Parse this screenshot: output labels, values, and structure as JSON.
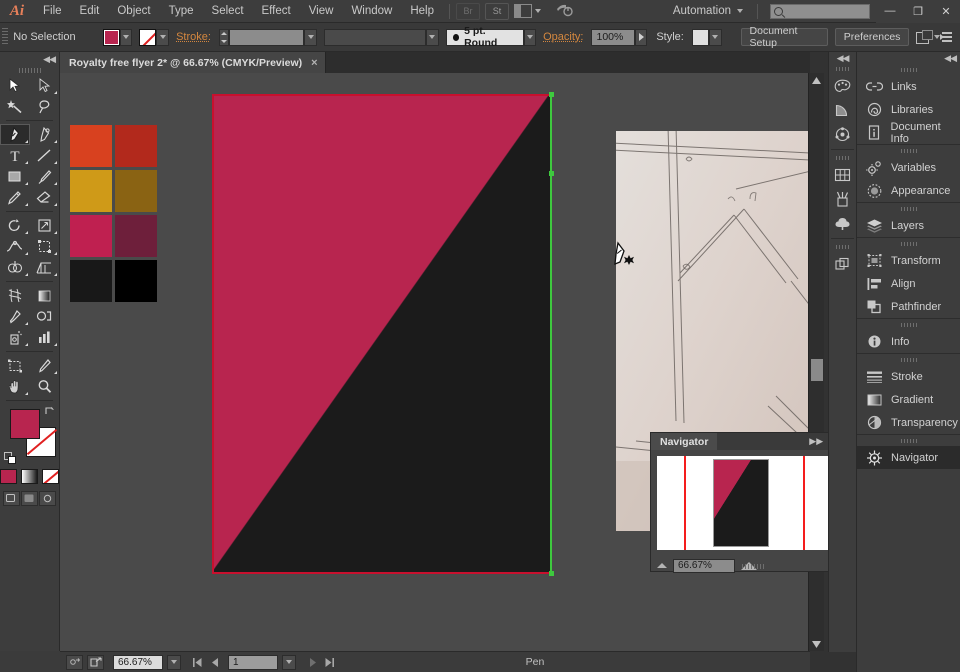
{
  "app": {
    "name": "Adobe Illustrator",
    "logo_text": "Ai"
  },
  "menubar": {
    "items": [
      "File",
      "Edit",
      "Object",
      "Type",
      "Select",
      "Effect",
      "View",
      "Window",
      "Help"
    ],
    "bridge_label": "Br",
    "stock_label": "St",
    "workspace_label": "Automation",
    "search_placeholder": "",
    "window_buttons": {
      "minimize": "—",
      "restore": "❐",
      "close": "✕"
    }
  },
  "controlbar": {
    "selection_state": "No Selection",
    "fill_color": "#b8254f",
    "stroke_color": "none",
    "stroke_label": "Stroke:",
    "stroke_weight": "",
    "brush_definition": "5 pt. Round",
    "opacity_label": "Opacity:",
    "opacity_value": "100%",
    "style_label": "Style:",
    "document_setup_label": "Document Setup",
    "preferences_label": "Preferences"
  },
  "tabbar": {
    "document_title": "Royalty free flyer 2* @ 66.67%  (CMYK/Preview)",
    "close_glyph": "×"
  },
  "toolbar": {
    "tools": [
      {
        "name": "selection-tool",
        "row": 0,
        "col": 0
      },
      {
        "name": "direct-selection-tool",
        "row": 0,
        "col": 1
      },
      {
        "name": "magic-wand-tool",
        "row": 1,
        "col": 0
      },
      {
        "name": "lasso-tool",
        "row": 1,
        "col": 1
      },
      {
        "name": "pen-tool",
        "row": 2,
        "col": 0,
        "active": true
      },
      {
        "name": "curvature-tool",
        "row": 2,
        "col": 1
      },
      {
        "name": "type-tool",
        "row": 3,
        "col": 0
      },
      {
        "name": "line-segment-tool",
        "row": 3,
        "col": 1
      },
      {
        "name": "rectangle-tool",
        "row": 4,
        "col": 0
      },
      {
        "name": "paintbrush-tool",
        "row": 4,
        "col": 1
      },
      {
        "name": "pencil-tool",
        "row": 5,
        "col": 0
      },
      {
        "name": "eraser-tool",
        "row": 5,
        "col": 1
      },
      {
        "name": "rotate-tool",
        "row": 6,
        "col": 0
      },
      {
        "name": "scale-tool",
        "row": 6,
        "col": 1
      },
      {
        "name": "width-tool",
        "row": 7,
        "col": 0
      },
      {
        "name": "free-transform-tool",
        "row": 7,
        "col": 1
      },
      {
        "name": "shape-builder-tool",
        "row": 8,
        "col": 0
      },
      {
        "name": "perspective-grid-tool",
        "row": 8,
        "col": 1
      },
      {
        "name": "mesh-tool",
        "row": 9,
        "col": 0
      },
      {
        "name": "gradient-tool",
        "row": 9,
        "col": 1
      },
      {
        "name": "eyedropper-tool",
        "row": 10,
        "col": 0
      },
      {
        "name": "blend-tool",
        "row": 10,
        "col": 1
      },
      {
        "name": "symbol-sprayer-tool",
        "row": 11,
        "col": 0
      },
      {
        "name": "column-graph-tool",
        "row": 11,
        "col": 1
      },
      {
        "name": "artboard-tool",
        "row": 12,
        "col": 0
      },
      {
        "name": "slice-tool",
        "row": 12,
        "col": 1
      },
      {
        "name": "hand-tool",
        "row": 13,
        "col": 0
      },
      {
        "name": "zoom-tool",
        "row": 13,
        "col": 1
      }
    ],
    "fill_color": "#b8254f",
    "stroke_color": "#ffffff"
  },
  "canvas": {
    "artboard": {
      "background_color": "#1b1b1b",
      "accent_color": "#b8254f",
      "border_color": "#c8102e",
      "selection_color": "#3ec93e"
    },
    "linked_photo": {
      "description": "pencil-sketch-paper-photo",
      "paper_color": "#ded6d0"
    },
    "swatch_palette": [
      [
        "#d8411f",
        "#b2291c"
      ],
      [
        "#cf9a18",
        "#8a6313"
      ],
      [
        "#bf2050",
        "#6e1f3b"
      ],
      [
        "#181818",
        "#000000"
      ]
    ]
  },
  "dock_collapsed": {
    "items": [
      {
        "label": "Color",
        "icon": "palette-icon"
      },
      {
        "label": "Color Guide",
        "icon": "color-guide-icon"
      },
      {
        "label": "Edit Colors",
        "icon": "edit-colors-icon"
      },
      {
        "label": "Swatches",
        "icon": "swatches-icon"
      },
      {
        "label": "Brushes",
        "icon": "brushes-icon"
      },
      {
        "label": "Symbols",
        "icon": "symbols-icon"
      },
      {
        "label": "Artboards",
        "icon": "artboards-icon"
      }
    ]
  },
  "dock_expanded": {
    "groups": [
      {
        "items": [
          {
            "label": "Links",
            "icon": "link-icon"
          },
          {
            "label": "Libraries",
            "icon": "libraries-icon"
          },
          {
            "label": "Document Info",
            "icon": "document-info-icon"
          }
        ]
      },
      {
        "items": [
          {
            "label": "Variables",
            "icon": "variables-icon"
          },
          {
            "label": "Appearance",
            "icon": "appearance-icon"
          }
        ]
      },
      {
        "items": [
          {
            "label": "Layers",
            "icon": "layers-icon"
          }
        ]
      },
      {
        "items": [
          {
            "label": "Transform",
            "icon": "transform-icon"
          },
          {
            "label": "Align",
            "icon": "align-icon"
          },
          {
            "label": "Pathfinder",
            "icon": "pathfinder-icon"
          }
        ]
      },
      {
        "items": [
          {
            "label": "Info",
            "icon": "info-icon"
          }
        ]
      },
      {
        "items": [
          {
            "label": "Stroke",
            "icon": "stroke-icon"
          },
          {
            "label": "Gradient",
            "icon": "gradient-icon"
          },
          {
            "label": "Transparency",
            "icon": "transparency-icon"
          }
        ]
      },
      {
        "items": [
          {
            "label": "Navigator",
            "icon": "navigator-icon",
            "selected": true
          }
        ]
      }
    ]
  },
  "navigator_panel": {
    "title": "Navigator",
    "zoom_value": "66.67%",
    "view_area_color": "#f41d1d",
    "expand_glyph": "▶▶"
  },
  "statusbar": {
    "zoom_value": "66.67%",
    "page_value": "1",
    "current_tool": "Pen"
  }
}
